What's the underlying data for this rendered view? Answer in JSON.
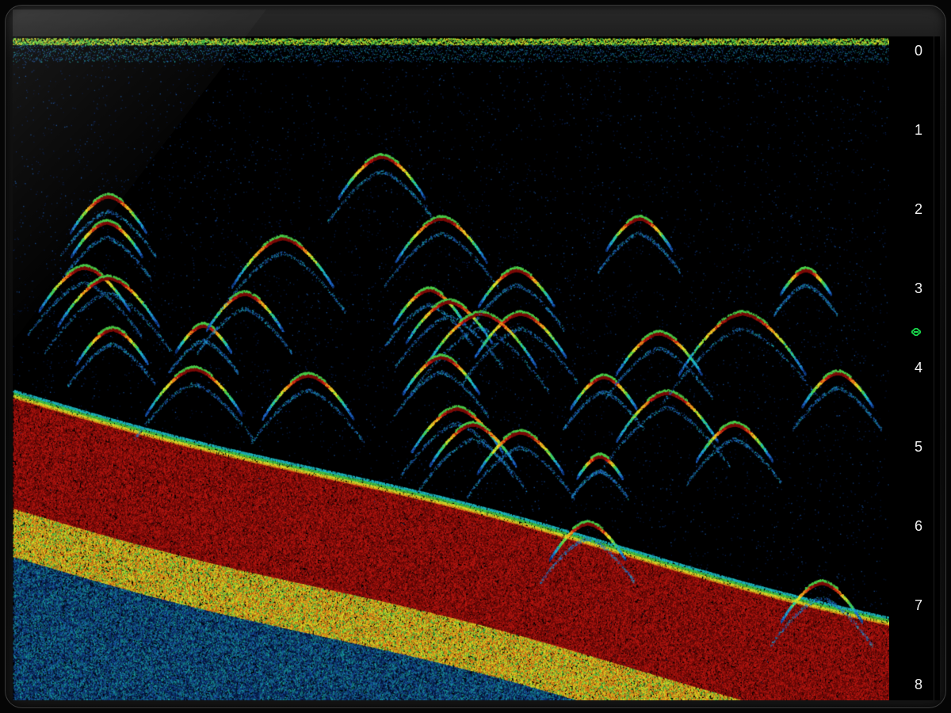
{
  "sonar": {
    "depth_labels": [
      "0",
      "1",
      "2",
      "3",
      "4",
      "5",
      "6",
      "7",
      "8"
    ],
    "depth_min": 0,
    "depth_max": 8,
    "marker_depth": 3.55,
    "colors": {
      "background": "#000000",
      "marker": "#19d44a",
      "palette": [
        "#0b2a6b",
        "#1f66c7",
        "#1fc0c9",
        "#4ad04a",
        "#e3e22a",
        "#f08a1a",
        "#c01812",
        "#7a0a08"
      ]
    }
  }
}
